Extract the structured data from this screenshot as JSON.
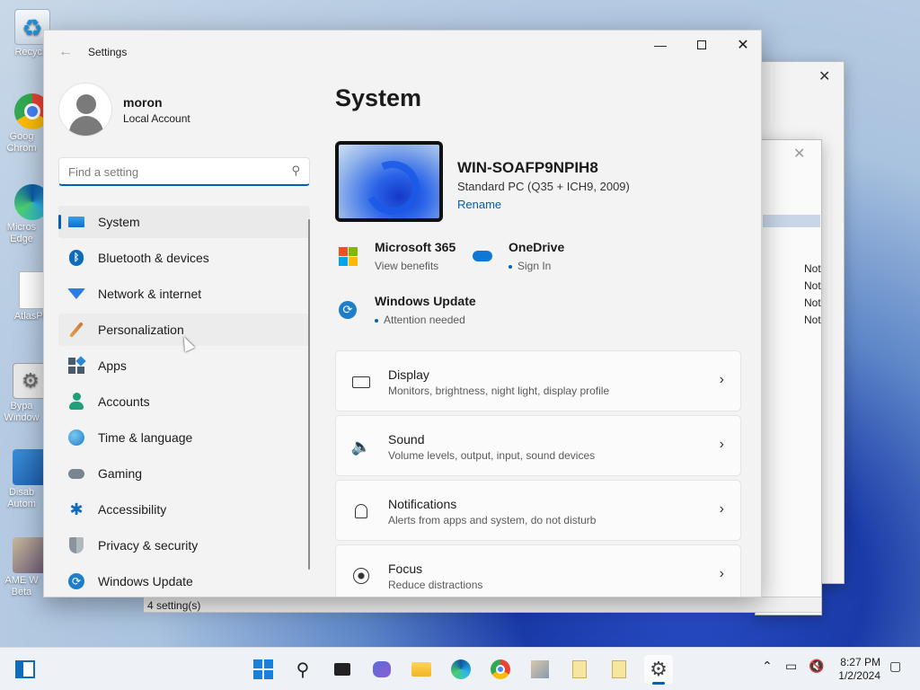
{
  "desktop": {
    "icons": [
      {
        "label": "Recycle",
        "icon": "recycle-bin-icon"
      },
      {
        "label": "Goog Chrom",
        "icon": "chrome-icon"
      },
      {
        "label": "Micros Edge",
        "icon": "edge-icon"
      },
      {
        "label": "AtlasPla",
        "icon": "file-icon"
      },
      {
        "label": "Bypa Window",
        "icon": "settings-shortcut-icon"
      },
      {
        "label": "Disab Autom",
        "icon": "registry-icon"
      },
      {
        "label": "AME W Beta",
        "icon": "ame-wizard-icon"
      }
    ]
  },
  "background_window": {
    "rows": [
      "Not",
      "Not",
      "Not",
      "Not"
    ],
    "status": "4 setting(s)"
  },
  "settings": {
    "title": "Settings",
    "profile": {
      "name": "moron",
      "account_type": "Local Account"
    },
    "search": {
      "placeholder": "Find a setting"
    },
    "nav": [
      {
        "label": "System",
        "icon": "system-display-icon",
        "selected": true
      },
      {
        "label": "Bluetooth & devices",
        "icon": "bluetooth-icon"
      },
      {
        "label": "Network & internet",
        "icon": "wifi-icon"
      },
      {
        "label": "Personalization",
        "icon": "paintbrush-icon",
        "hover": true
      },
      {
        "label": "Apps",
        "icon": "apps-icon"
      },
      {
        "label": "Accounts",
        "icon": "accounts-icon"
      },
      {
        "label": "Time & language",
        "icon": "globe-clock-icon"
      },
      {
        "label": "Gaming",
        "icon": "gamepad-icon"
      },
      {
        "label": "Accessibility",
        "icon": "accessibility-icon"
      },
      {
        "label": "Privacy & security",
        "icon": "shield-icon"
      },
      {
        "label": "Windows Update",
        "icon": "windows-update-icon"
      }
    ],
    "page_title": "System",
    "device": {
      "name": "WIN-SOAFP9NPIH8",
      "model": "Standard PC (Q35 + ICH9, 2009)",
      "rename_label": "Rename"
    },
    "quick_links": [
      {
        "title": "Microsoft 365",
        "subtitle": "View benefits",
        "icon": "microsoft-logo-icon"
      },
      {
        "title": "OneDrive",
        "subtitle": "Sign In",
        "icon": "onedrive-cloud-icon"
      },
      {
        "title": "Windows Update",
        "subtitle": "Attention needed",
        "icon": "windows-update-icon"
      }
    ],
    "cards": [
      {
        "title": "Display",
        "subtitle": "Monitors, brightness, night light, display profile",
        "icon": "monitor-icon"
      },
      {
        "title": "Sound",
        "subtitle": "Volume levels, output, input, sound devices",
        "icon": "speaker-icon"
      },
      {
        "title": "Notifications",
        "subtitle": "Alerts from apps and system, do not disturb",
        "icon": "bell-icon"
      },
      {
        "title": "Focus",
        "subtitle": "Reduce distractions",
        "icon": "focus-icon"
      }
    ]
  },
  "taskbar": {
    "time": "8:27 PM",
    "date": "1/2/2024"
  },
  "colors": {
    "accent": "#005fb8"
  }
}
